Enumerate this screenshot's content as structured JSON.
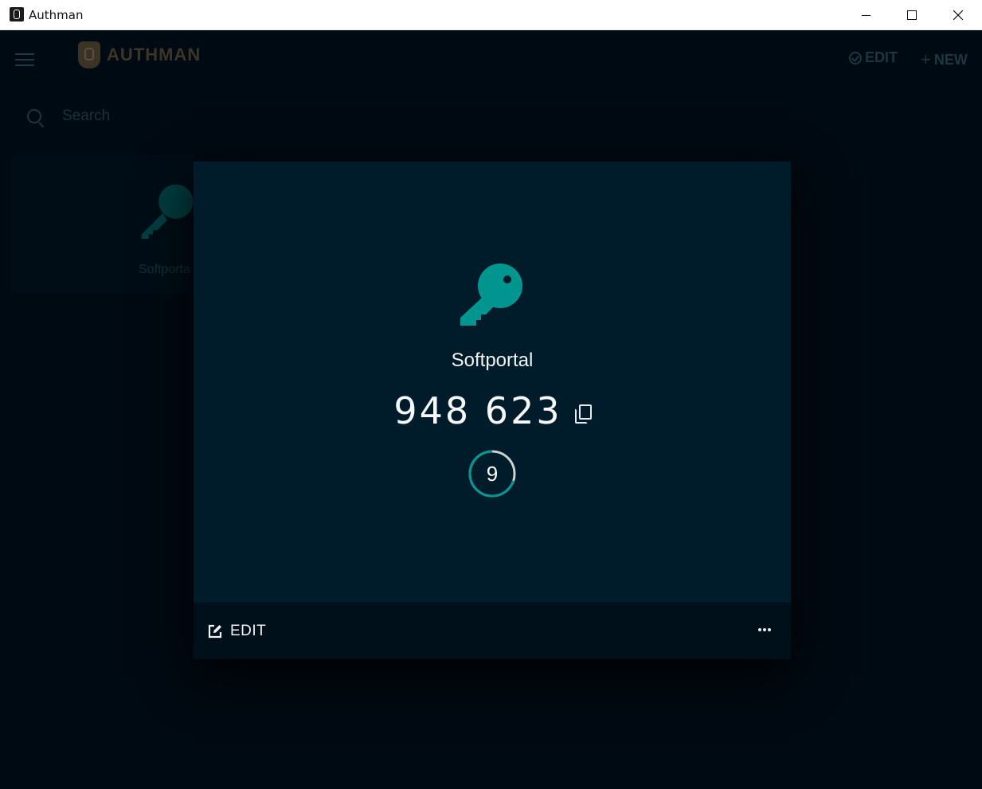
{
  "window": {
    "title": "Authman"
  },
  "app": {
    "logo_text": "AUTHMAN",
    "toolbar": {
      "edit_label": "EDIT",
      "new_label": "NEW"
    },
    "search": {
      "placeholder": "Search"
    },
    "background_card": {
      "label": "Softporta"
    }
  },
  "dialog": {
    "entry_name": "Softportal",
    "otp_code": "948 623",
    "timer_seconds": "9",
    "timer_progress": 0.3,
    "footer": {
      "edit_label": "EDIT"
    }
  },
  "colors": {
    "accent": "#00968f",
    "dialog_bg": "#001b29",
    "footer_bg": "#00101a",
    "app_bg": "#000a12"
  },
  "icons": [
    "app-icon",
    "hamburger-icon",
    "logo-shield-icon",
    "check-circle-icon",
    "plus-icon",
    "search-icon",
    "key-icon",
    "copy-icon",
    "edit-icon",
    "more-icon"
  ]
}
